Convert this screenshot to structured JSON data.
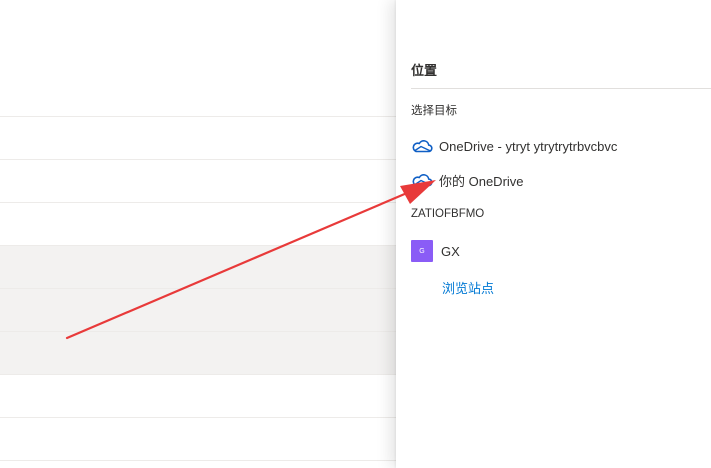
{
  "panel": {
    "title": "位置",
    "select_target_label": "选择目标",
    "locations": [
      {
        "label": "OneDrive - ytryt ytrytrytrbvcbvc",
        "icon": "onedrive-cloud-icon"
      },
      {
        "label": "你的 OneDrive",
        "icon": "onedrive-cloud-icon"
      }
    ],
    "sites_group_label": "ZATIOFBFMO",
    "site": {
      "avatar_letter": "G",
      "label": "GX",
      "avatar_color": "#8a5cf6"
    },
    "browse_link": "浏览站点"
  },
  "colors": {
    "accent": "#0078d4",
    "cloud_icon": "#0f5fc5",
    "annotation_arrow": "#e83a3a",
    "row_shade": "#f3f2f1"
  }
}
